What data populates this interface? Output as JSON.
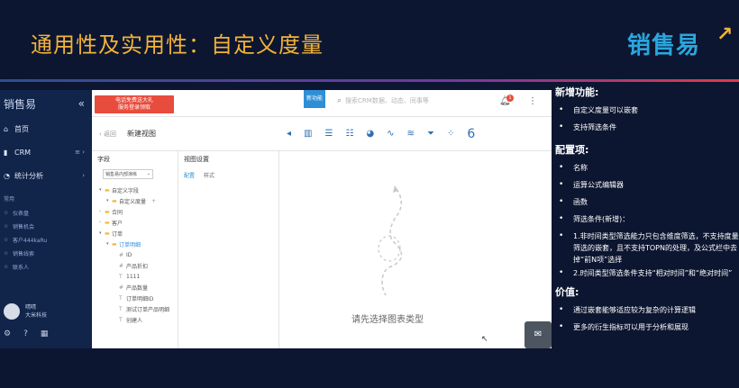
{
  "slide": {
    "title": "通用性及实用性：自定义度量",
    "brand": "销售易",
    "brand_arrow": "↗"
  },
  "app": {
    "sidebar": {
      "logo": "销售易",
      "collapse": "«",
      "items": [
        {
          "icon": "⌂",
          "label": "首页",
          "trail": ""
        },
        {
          "icon": "▮",
          "label": "CRM",
          "trail": "≡ ›"
        },
        {
          "icon": "◔",
          "label": "统计分析",
          "trail": "›"
        }
      ],
      "section_label": "常用",
      "favorites": [
        "仪表盘",
        "销售机会",
        "客户444kaRu",
        "销售线索",
        "联系人"
      ],
      "user_name": "晴晴",
      "user_org": "大米科技",
      "footer_icons": [
        "⚙",
        "?",
        "▦"
      ]
    },
    "topbar": {
      "banner_line1": "电话免费送大礼",
      "banner_line2": "服务登录领取",
      "new_label": "新功能",
      "search_placeholder": "搜索CRM数据、动态、同事等",
      "badge_count": "1",
      "menu": "⋮"
    },
    "subbar": {
      "back_label": "‹ 返回",
      "title": "新建视图"
    },
    "fields_panel": {
      "heading": "字段",
      "select_value": "销售易内部演练",
      "select_caret": "⌄",
      "tree": [
        {
          "arrow": "▾",
          "icon": "▬",
          "label": "自定义字段",
          "indent": 0,
          "blue": false
        },
        {
          "arrow": "▾",
          "icon": "▬",
          "label": "自定义度量",
          "indent": 1,
          "blue": false,
          "plus": "+"
        },
        {
          "arrow": "›",
          "icon": "▬",
          "label": "合同",
          "indent": 0,
          "blue": false
        },
        {
          "arrow": "›",
          "icon": "▬",
          "label": "客户",
          "indent": 0,
          "blue": false
        },
        {
          "arrow": "▾",
          "icon": "▬",
          "label": "订单",
          "indent": 0,
          "blue": false
        },
        {
          "arrow": "▾",
          "icon": "▬",
          "label": "订单明细",
          "indent": 1,
          "blue": true
        },
        {
          "arrow": "",
          "icon": "#",
          "label": "ID",
          "indent": 2,
          "blue": false
        },
        {
          "arrow": "",
          "icon": "#",
          "label": "产品折扣",
          "indent": 2,
          "blue": false
        },
        {
          "arrow": "",
          "icon": "T",
          "label": "1111",
          "indent": 2,
          "blue": false
        },
        {
          "arrow": "",
          "icon": "#",
          "label": "产品数量",
          "indent": 2,
          "blue": false
        },
        {
          "arrow": "",
          "icon": "T",
          "label": "订单明细ID",
          "indent": 2,
          "blue": false
        },
        {
          "arrow": "",
          "icon": "T",
          "label": "测试订单产品明细",
          "indent": 2,
          "blue": false
        },
        {
          "arrow": "",
          "icon": "T",
          "label": "创建人",
          "indent": 2,
          "blue": false
        }
      ]
    },
    "config_panel": {
      "heading": "视图设置",
      "tab_active": "配置",
      "tab_other": "样式"
    },
    "chart_types": [
      {
        "icon": "◂",
        "name": "prev-icon"
      },
      {
        "icon": "▥",
        "name": "column-chart-icon"
      },
      {
        "icon": "☰",
        "name": "bar-chart-icon"
      },
      {
        "icon": "☷",
        "name": "stacked-bar-icon"
      },
      {
        "icon": "◕",
        "name": "pie-chart-icon"
      },
      {
        "icon": "∿",
        "name": "line-chart-icon"
      },
      {
        "icon": "≋",
        "name": "area-chart-icon"
      },
      {
        "icon": "⏷",
        "name": "funnel-chart-icon"
      },
      {
        "icon": "⁘",
        "name": "scatter-chart-icon"
      },
      {
        "icon": "6",
        "name": "number-chart-icon"
      }
    ],
    "canvas": {
      "placeholder": "请先选择图表类型",
      "cursor": "↖",
      "chat": "✉"
    }
  },
  "notes": {
    "new_features_title": "新增功能:",
    "new_features": [
      "自定义度量可以嵌套",
      "支持筛选条件"
    ],
    "config_title": "配置项:",
    "config_items": [
      "名称",
      "运算公式编辑器",
      "函数",
      "筛选条件(新增)：",
      "1.非时间类型筛选能力只包含维度筛选，不支持度量筛选的嵌套，且不支持TOPN的处理，及公式栏中去掉“前N项”选择",
      "2.时间类型筛选条件支持“相对时间”和“绝对时间”"
    ],
    "value_title": "价值:",
    "value_items": [
      "通过嵌套能够适应较为复杂的计算逻辑",
      "更多的衍生指标可以用于分析和展现"
    ]
  }
}
